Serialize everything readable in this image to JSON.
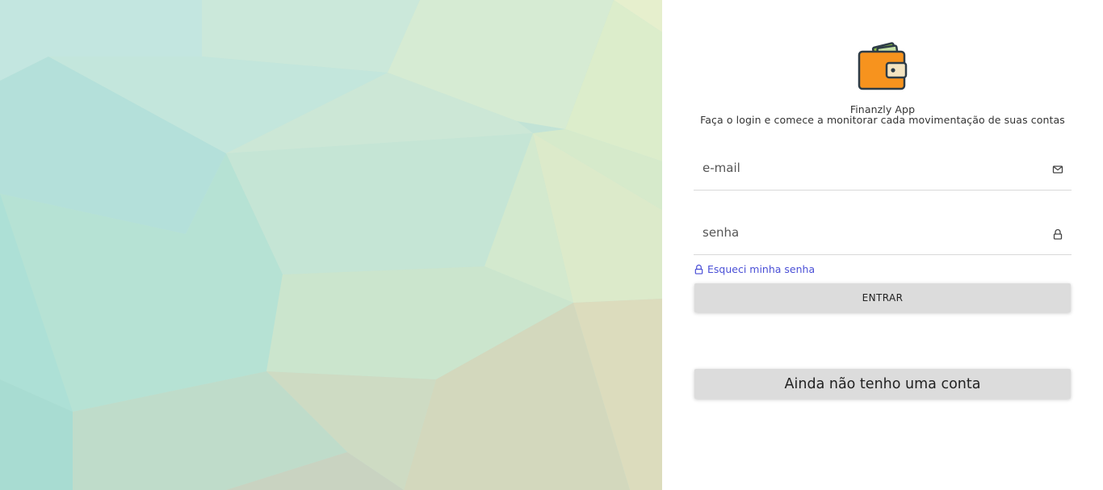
{
  "app": {
    "name": "Finanzly App",
    "subtitle": "Faça o login e comece a monitorar cada movimentação de suas contas",
    "logo_icon": "wallet-icon"
  },
  "form": {
    "email": {
      "value": "",
      "placeholder": "e-mail",
      "icon": "mail-icon"
    },
    "password": {
      "value": "",
      "placeholder": "senha",
      "icon": "lock-icon"
    },
    "forgot_label": "Esqueci minha senha",
    "forgot_icon": "lock-icon",
    "login_label": "ENTRAR",
    "signup_label": "Ainda não tenho uma conta"
  },
  "colors": {
    "link": "#4a4fd6",
    "button_bg": "#dcdcdc",
    "wallet_orange": "#f7931e",
    "wallet_money": "#8bc34a"
  }
}
